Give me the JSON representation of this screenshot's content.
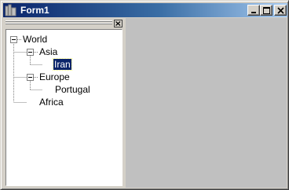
{
  "window": {
    "title": "Form1",
    "icon": "form-app-icon",
    "buttons": [
      "minimize-icon",
      "maximize-icon",
      "close-icon"
    ]
  },
  "panel": {
    "close_icon": "close-icon"
  },
  "tree": {
    "root": {
      "label": "World",
      "expanded": true
    },
    "nodes": [
      {
        "label": "Asia",
        "expanded": true
      },
      {
        "label": "Iran",
        "selected": true
      },
      {
        "label": "Europe",
        "expanded": true
      },
      {
        "label": "Portugal"
      },
      {
        "label": "Africa"
      }
    ]
  },
  "colors": {
    "titlebar_start": "#0a246a",
    "titlebar_end": "#a6caf0",
    "selection": "#0a246a",
    "window_face": "#d4d0c8",
    "client_gray": "#c0c0c0"
  }
}
